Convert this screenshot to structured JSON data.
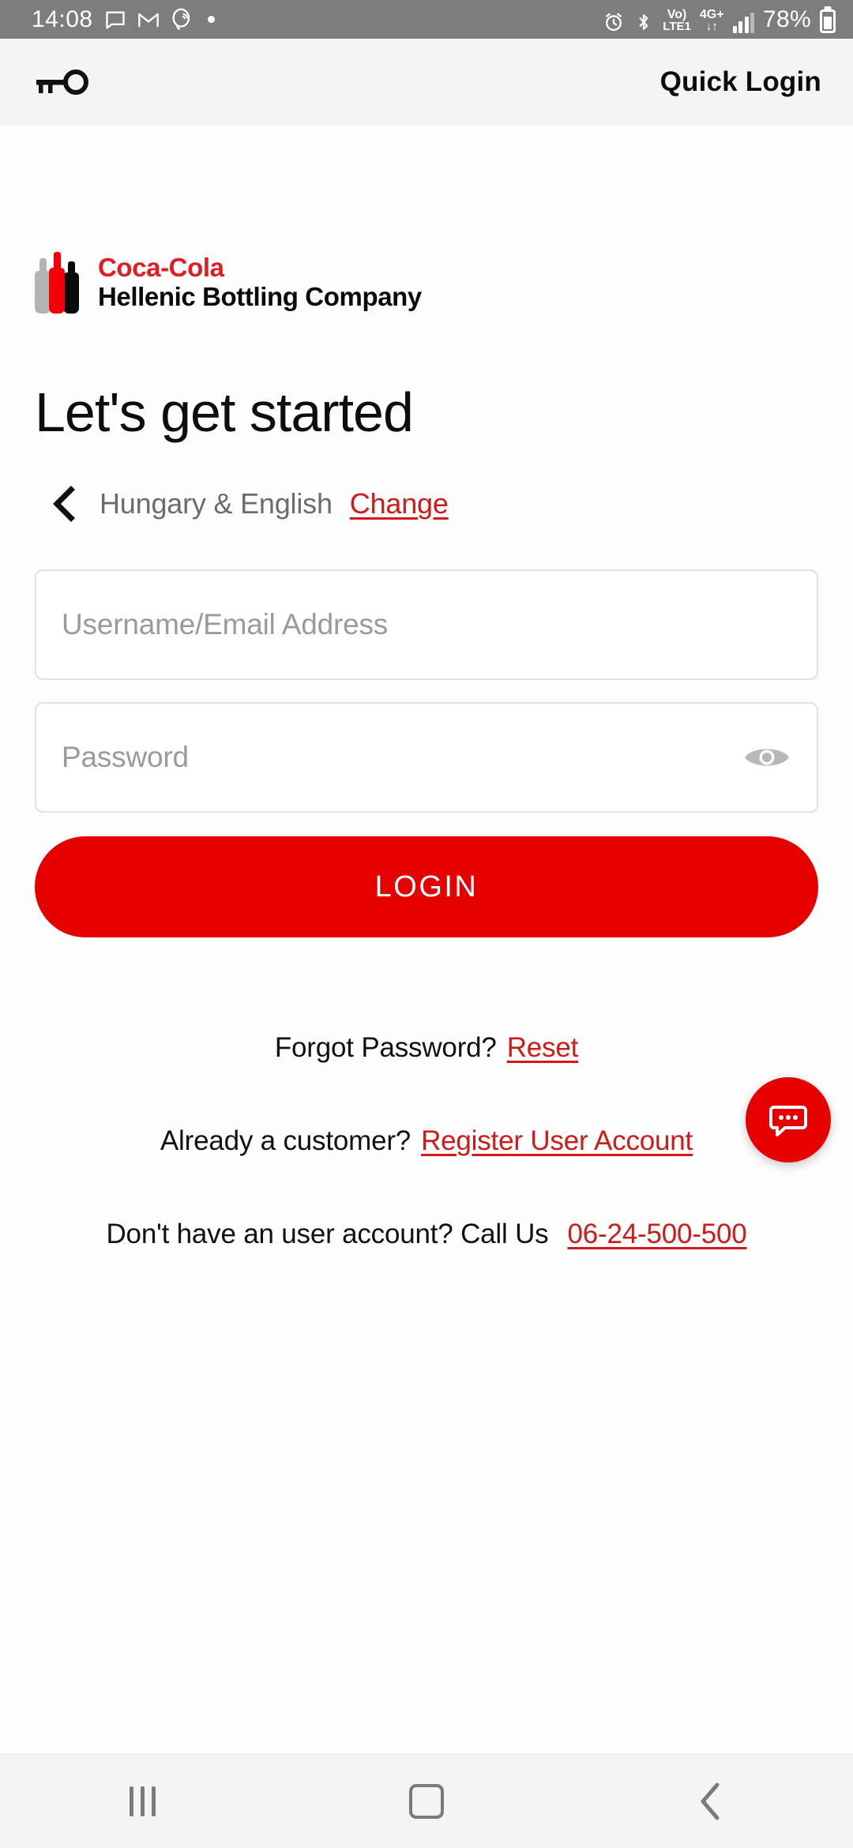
{
  "status_bar": {
    "time": "14:08",
    "battery_percent": "78%",
    "network_line1": "Vo)",
    "network_line2": "LTE1",
    "network_type": "4G+",
    "icons": [
      "message-icon",
      "gmail-icon",
      "viber-icon",
      "dot-indicator",
      "alarm-icon",
      "bluetooth-icon",
      "volte-icon",
      "signal-icon",
      "battery-icon"
    ],
    "background": "#7d7d7d"
  },
  "app_bar": {
    "key_icon": "key-icon",
    "quick_login_label": "Quick Login"
  },
  "brand": {
    "line1": "Coca-Cola",
    "line2": "Hellenic Bottling Company",
    "red": "#e31b23",
    "black": "#0a0a0a",
    "bottle_colors": [
      "#b3b3b3",
      "#f40009",
      "#0a0a0a"
    ]
  },
  "main": {
    "headline": "Let's get started",
    "locale": {
      "back_icon": "chevron-left-icon",
      "text": "Hungary & English",
      "change_label": "Change"
    },
    "username_placeholder": "Username/Email Address",
    "password_placeholder": "Password",
    "password_toggle_icon": "eye-icon",
    "login_label": "LOGIN"
  },
  "footer": {
    "forgot_text": "Forgot Password?",
    "forgot_link": "Reset",
    "customer_text": "Already a customer?",
    "customer_link": "Register User Account",
    "call_text": "Don't have an user account? Call Us",
    "call_link": "06-24-500-500",
    "chat_icon": "chat-bubble-icon",
    "accent_red": "#cf1a17",
    "button_red": "#e60000"
  },
  "nav_bar": {
    "recents_icon": "recents-icon",
    "home_icon": "home-icon",
    "back_icon": "back-icon"
  }
}
